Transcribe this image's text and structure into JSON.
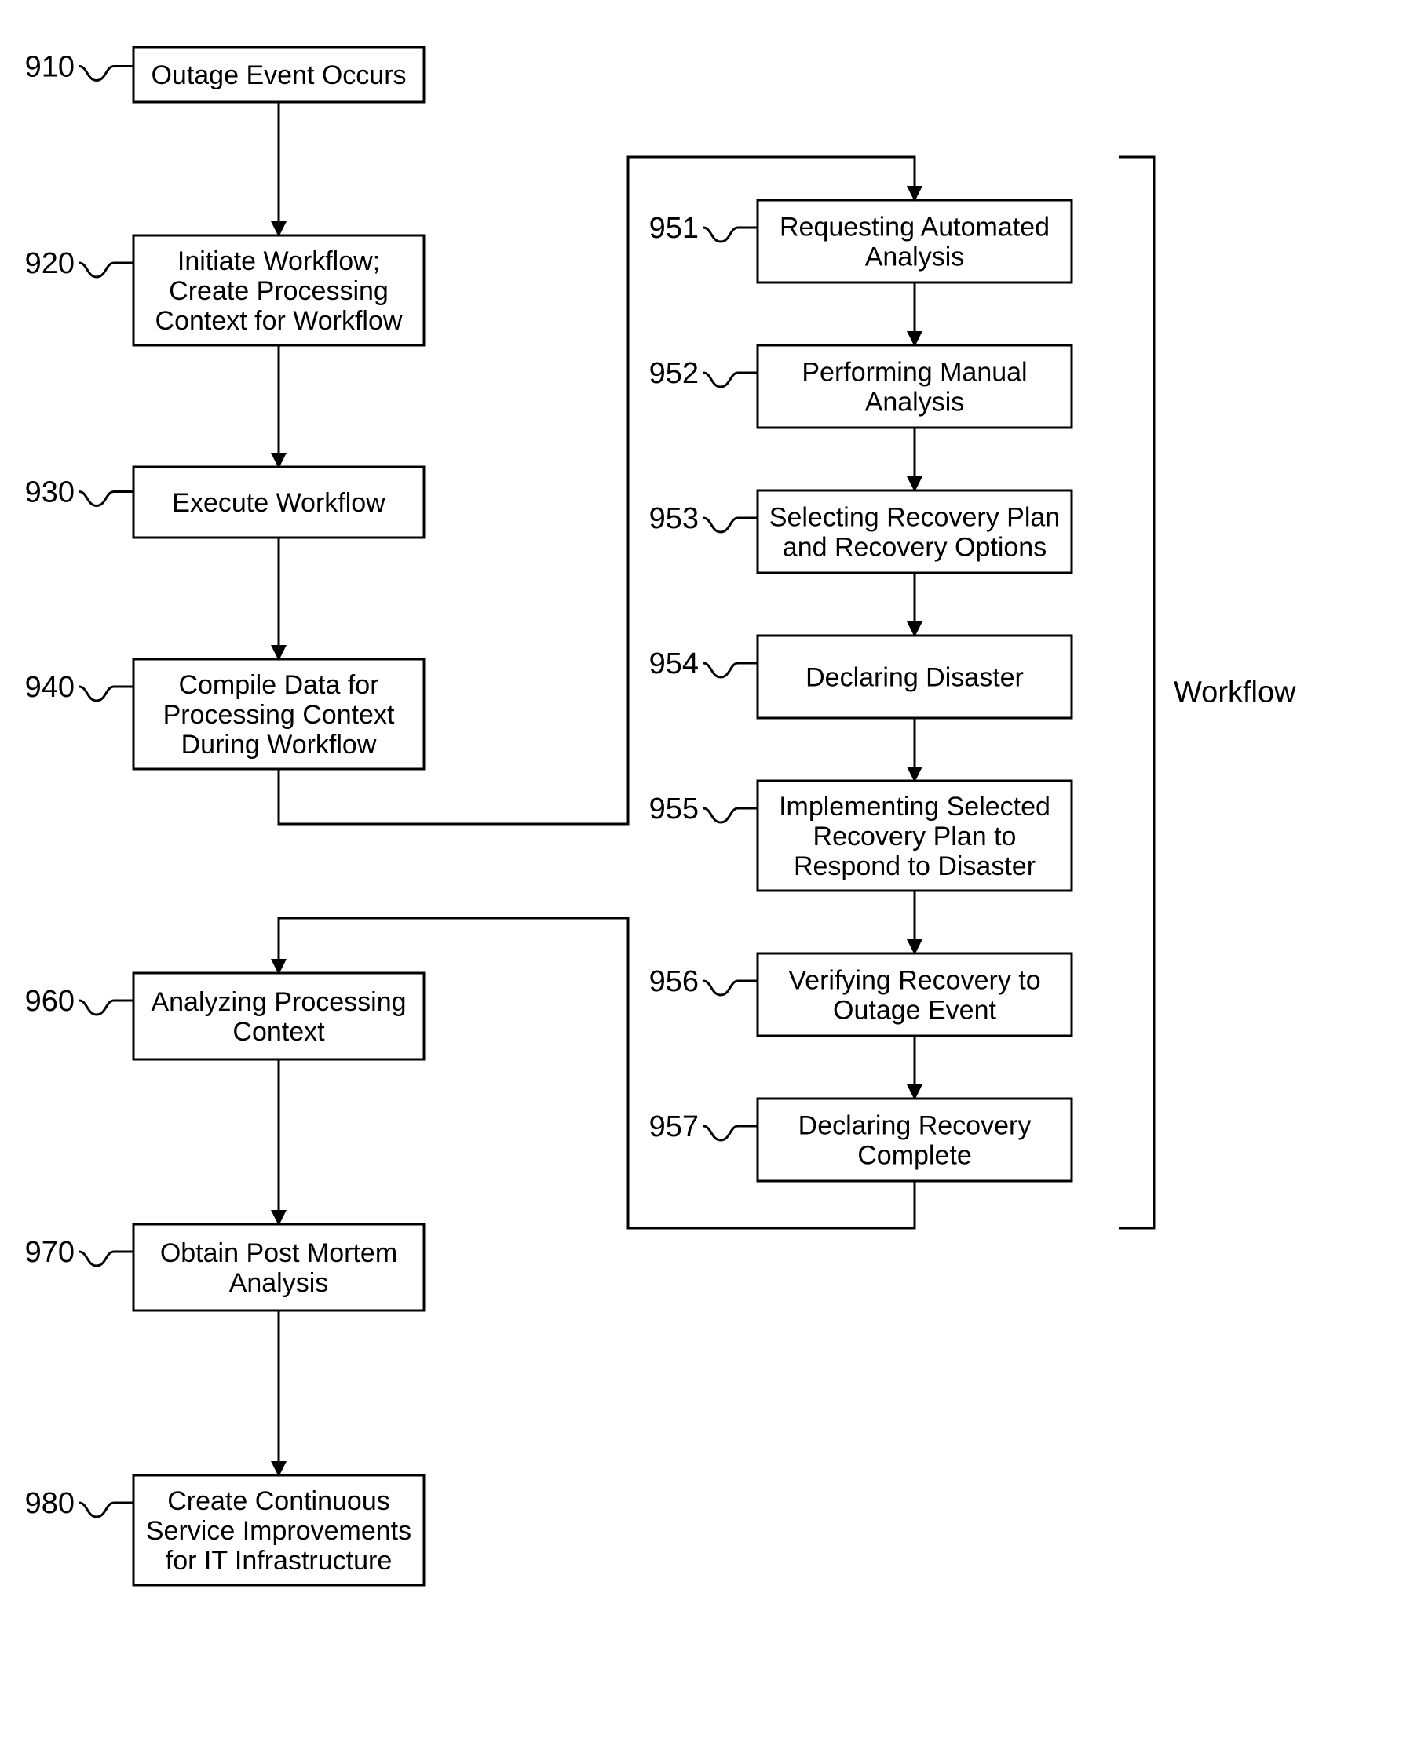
{
  "nodes": {
    "n910": {
      "num": "910",
      "lines": [
        "Outage Event Occurs"
      ]
    },
    "n920": {
      "num": "920",
      "lines": [
        "Initiate Workflow;",
        "Create Processing",
        "Context for Workflow"
      ]
    },
    "n930": {
      "num": "930",
      "lines": [
        "Execute Workflow"
      ]
    },
    "n940": {
      "num": "940",
      "lines": [
        "Compile Data for",
        "Processing Context",
        "During Workflow"
      ]
    },
    "n960": {
      "num": "960",
      "lines": [
        "Analyzing Processing",
        "Context"
      ]
    },
    "n970": {
      "num": "970",
      "lines": [
        "Obtain Post Mortem",
        "Analysis"
      ]
    },
    "n980": {
      "num": "980",
      "lines": [
        "Create Continuous",
        "Service Improvements",
        "for IT Infrastructure"
      ]
    },
    "n951": {
      "num": "951",
      "lines": [
        "Requesting Automated",
        "Analysis"
      ]
    },
    "n952": {
      "num": "952",
      "lines": [
        "Performing Manual",
        "Analysis"
      ]
    },
    "n953": {
      "num": "953",
      "lines": [
        "Selecting Recovery Plan",
        "and Recovery Options"
      ]
    },
    "n954": {
      "num": "954",
      "lines": [
        "Declaring Disaster"
      ]
    },
    "n955": {
      "num": "955",
      "lines": [
        "Implementing Selected",
        "Recovery Plan to",
        "Respond to Disaster"
      ]
    },
    "n956": {
      "num": "956",
      "lines": [
        "Verifying Recovery to",
        "Outage Event"
      ]
    },
    "n957": {
      "num": "957",
      "lines": [
        "Declaring Recovery",
        "Complete"
      ]
    }
  },
  "side_label": "Workflow"
}
